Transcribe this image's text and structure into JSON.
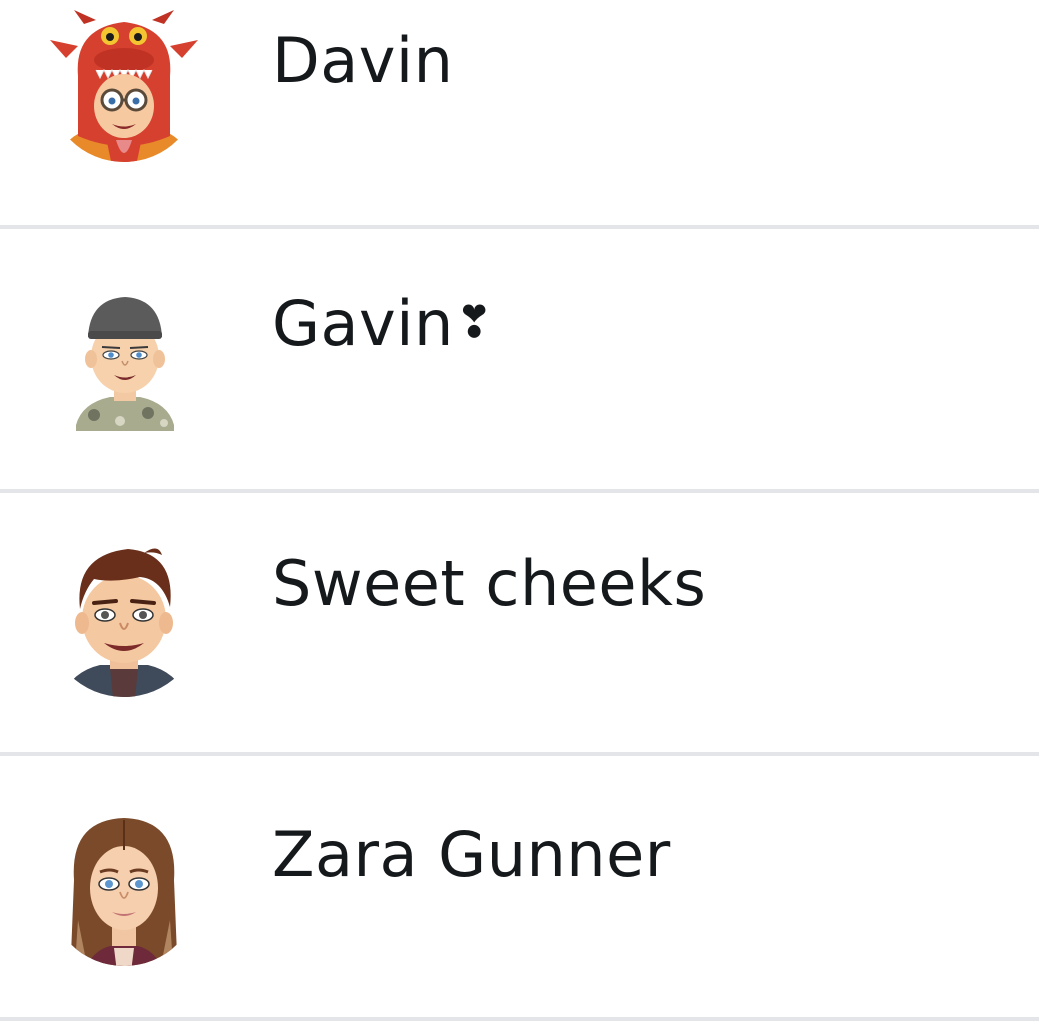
{
  "contacts": [
    {
      "name": "Davin",
      "suffix": "",
      "avatar_icon": "bitmoji-dragon-costume-icon"
    },
    {
      "name": "Gavin",
      "suffix": "❣",
      "avatar_icon": "bitmoji-cap-camo-icon"
    },
    {
      "name": "Sweet cheeks",
      "suffix": "",
      "avatar_icon": "bitmoji-brown-hair-hoodie-icon"
    },
    {
      "name": "Zara Gunner",
      "suffix": "",
      "avatar_icon": "bitmoji-long-hair-woman-icon"
    }
  ],
  "colors": {
    "text": "#16191c",
    "divider": "#e3e5e8",
    "background": "#ffffff"
  }
}
